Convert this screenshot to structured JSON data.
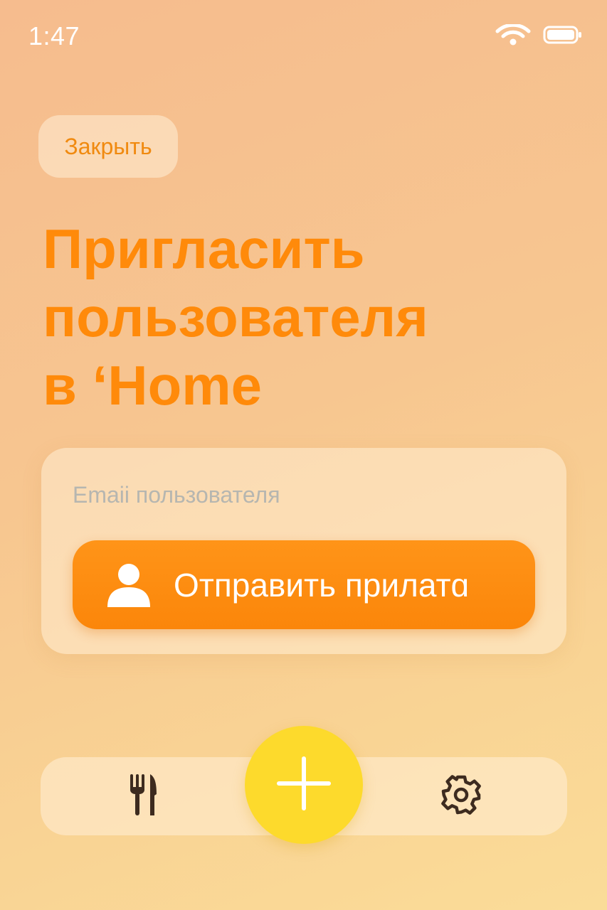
{
  "status_bar": {
    "time": "1:47",
    "icons": [
      "wifi-icon",
      "battery-icon"
    ]
  },
  "header": {
    "close_label": "Закрыть"
  },
  "title": {
    "lines": [
      "Пригласить",
      "пользователя",
      "в ‘Home"
    ]
  },
  "invite_form": {
    "email_placeholder": "Emaii пользователя",
    "email_value": "",
    "send_button_label": "Отправить прилатɑ",
    "send_button_icon": "person-icon"
  },
  "tab_bar": {
    "left_icon": "fork-knife-icon",
    "center_icon": "plus-icon",
    "right_icon": "gear-icon"
  },
  "colors": {
    "accent": "#ff8a0a",
    "button": "#fb8a0c",
    "fab": "#fdda2c",
    "icon_dark": "#3d2b1f"
  }
}
